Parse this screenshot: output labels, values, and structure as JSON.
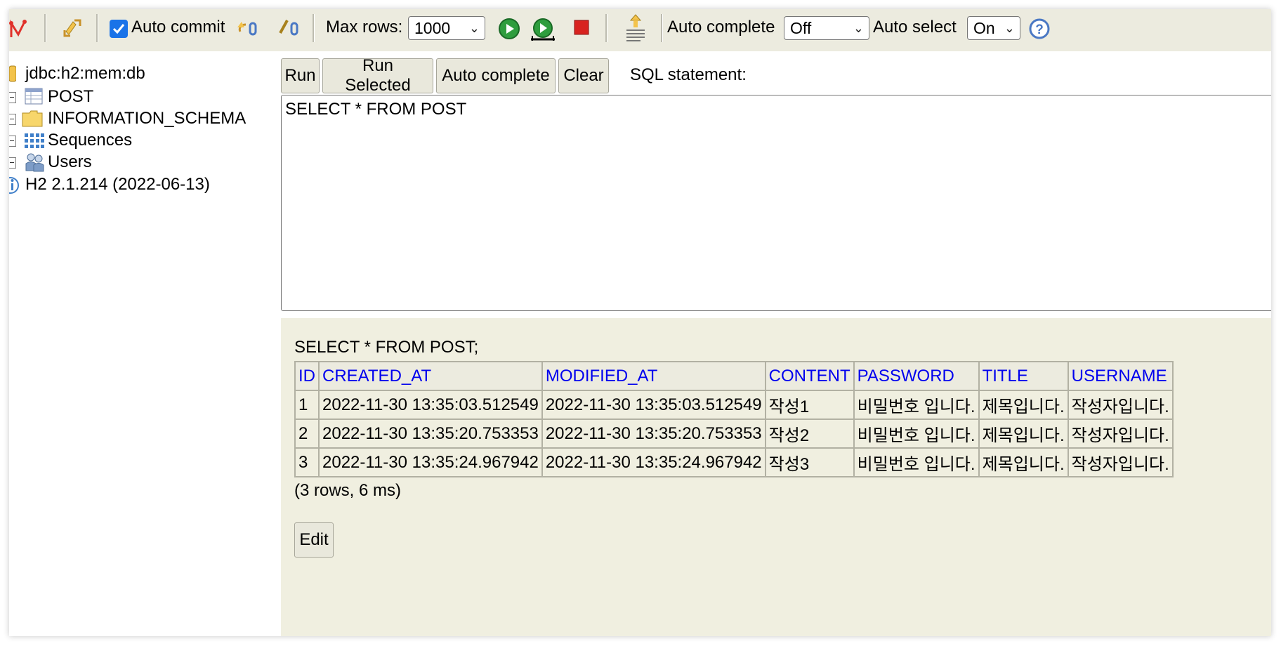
{
  "toolbar": {
    "auto_commit_label": "Auto commit",
    "auto_commit_checked": true,
    "max_rows_label": "Max rows:",
    "max_rows_value": "1000",
    "auto_complete_label": "Auto complete",
    "auto_complete_value": "Off",
    "auto_select_label": "Auto select",
    "auto_select_value": "On",
    "icons": [
      "disconnect-icon",
      "refresh-icon",
      "rollback-icon",
      "commit-icon",
      "run-icon",
      "run-selected-icon",
      "stop-icon",
      "history-icon",
      "help-icon"
    ],
    "accent_checkbox": "#1a73e8"
  },
  "tree": {
    "connection": "jdbc:h2:mem:db",
    "items": [
      {
        "label": "POST",
        "icon": "table-icon"
      },
      {
        "label": "INFORMATION_SCHEMA",
        "icon": "folder-icon"
      },
      {
        "label": "Sequences",
        "icon": "sequences-icon"
      },
      {
        "label": "Users",
        "icon": "users-icon"
      }
    ],
    "version": "H2 2.1.214 (2022-06-13)"
  },
  "query": {
    "run": "Run",
    "run_selected": "Run Selected",
    "auto_complete": "Auto complete",
    "clear": "Clear",
    "sql_label": "SQL statement:",
    "sql_text": "SELECT * FROM POST"
  },
  "results": {
    "title": "SELECT * FROM POST;",
    "columns": [
      "ID",
      "CREATED_AT",
      "MODIFIED_AT",
      "CONTENT",
      "PASSWORD",
      "TITLE",
      "USERNAME"
    ],
    "rows": [
      [
        "1",
        "2022-11-30 13:35:03.512549",
        "2022-11-30 13:35:03.512549",
        "작성1",
        "비밀번호 입니다.",
        "제목입니다.",
        "작성자입니다."
      ],
      [
        "2",
        "2022-11-30 13:35:20.753353",
        "2022-11-30 13:35:20.753353",
        "작성2",
        "비밀번호 입니다.",
        "제목입니다.",
        "작성자입니다."
      ],
      [
        "3",
        "2022-11-30 13:35:24.967942",
        "2022-11-30 13:35:24.967942",
        "작성3",
        "비밀번호 입니다.",
        "제목입니다.",
        "작성자입니다."
      ]
    ],
    "row_count": "(3 rows, 6 ms)",
    "edit": "Edit",
    "header_color": "#0000ee",
    "background": "#f0efe0"
  }
}
